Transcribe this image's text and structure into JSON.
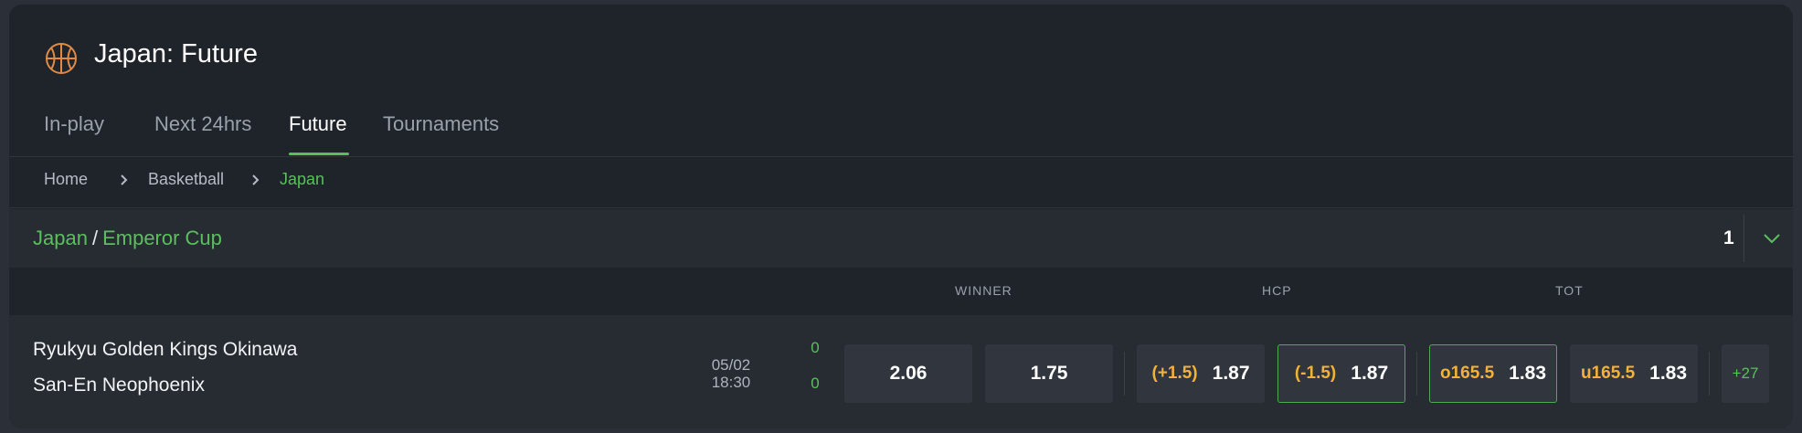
{
  "header": {
    "title": "Japan: Future",
    "sport_icon": "basketball-icon"
  },
  "tabs": [
    {
      "label": "In-play",
      "active": false
    },
    {
      "label": "Next 24hrs",
      "active": false
    },
    {
      "label": "Future",
      "active": true
    },
    {
      "label": "Tournaments",
      "active": false
    }
  ],
  "breadcrumb": [
    "Home",
    "Basketball",
    "Japan"
  ],
  "league": {
    "country": "Japan",
    "separator": "/",
    "competition": "Emperor Cup",
    "count": "1"
  },
  "markets": {
    "winner": "WINNER",
    "hcp": "HCP",
    "tot": "TOT"
  },
  "event": {
    "home": "Ryukyu Golden Kings Okinawa",
    "away": "San-En Neophoenix",
    "date": "05/02",
    "time": "18:30",
    "home_score": "0",
    "away_score": "0",
    "odds": {
      "winner_home": "2.06",
      "winner_away": "1.75",
      "hcp_home_line": "(+1.5)",
      "hcp_home_odd": "1.87",
      "hcp_away_line": "(-1.5)",
      "hcp_away_odd": "1.87",
      "over_line": "o165.5",
      "over_odd": "1.83",
      "under_line": "u165.5",
      "under_odd": "1.83",
      "more": "+27"
    }
  },
  "colors": {
    "accent_green": "#5cbf5e",
    "line_orange": "#f1b13c",
    "panel_bg": "#1f242b",
    "row_bg": "#272c33"
  }
}
